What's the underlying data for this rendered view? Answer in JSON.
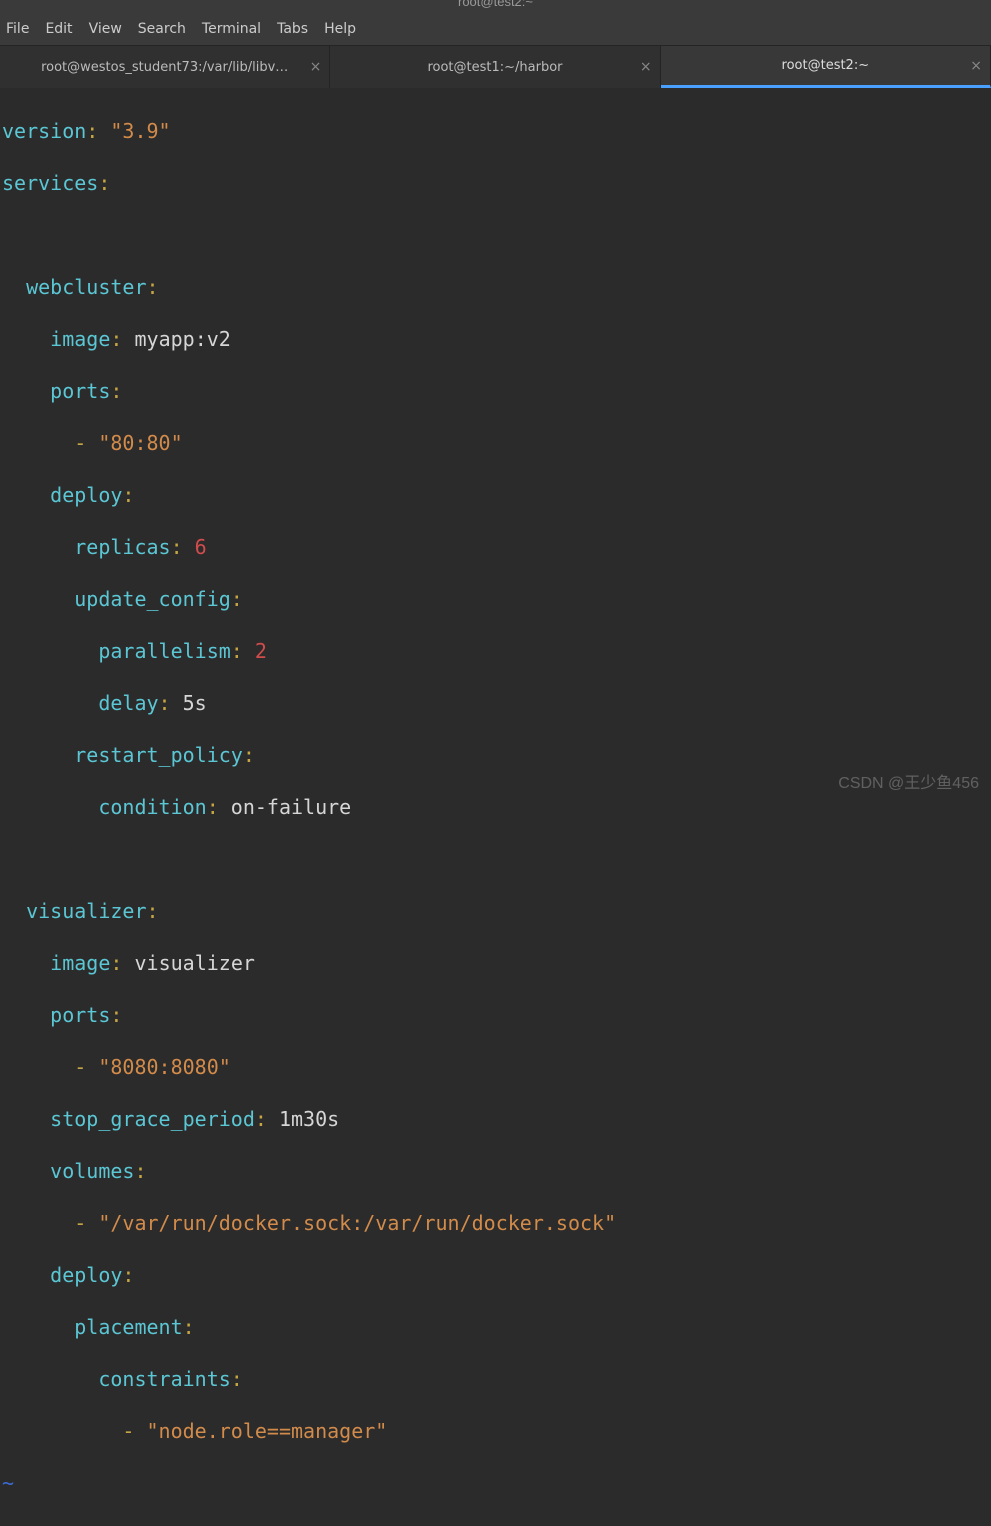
{
  "window": {
    "title": "root@test2:~"
  },
  "menubar": {
    "items": [
      "File",
      "Edit",
      "View",
      "Search",
      "Terminal",
      "Tabs",
      "Help"
    ]
  },
  "tabs": [
    {
      "label": "root@westos_student73:/var/lib/libv…",
      "active": false
    },
    {
      "label": "root@test1:~/harbor",
      "active": false
    },
    {
      "label": "root@test2:~",
      "active": true
    }
  ],
  "yaml": {
    "version_key": "version",
    "version_val": "\"3.9\"",
    "services_key": "services",
    "webcluster": {
      "name": "webcluster",
      "image_key": "image",
      "image_val": "myapp:v2",
      "ports_key": "ports",
      "port0": "\"80:80\"",
      "deploy_key": "deploy",
      "replicas_key": "replicas",
      "replicas_val": "6",
      "update_config_key": "update_config",
      "parallelism_key": "parallelism",
      "parallelism_val": "2",
      "delay_key": "delay",
      "delay_val": "5s",
      "restart_policy_key": "restart_policy",
      "condition_key": "condition",
      "condition_val": "on-failure"
    },
    "visualizer": {
      "name": "visualizer",
      "image_key": "image",
      "image_val": "visualizer",
      "ports_key": "ports",
      "port0": "\"8080:8080\"",
      "stop_grace_period_key": "stop_grace_period",
      "stop_grace_period_val": "1m30s",
      "volumes_key": "volumes",
      "vol0": "\"/var/run/docker.sock:/var/run/docker.sock\"",
      "deploy_key": "deploy",
      "placement_key": "placement",
      "constraints_key": "constraints",
      "constraint0": "\"node.role==manager\""
    },
    "tilde": "~"
  },
  "watermark": "CSDN @王少鱼456"
}
